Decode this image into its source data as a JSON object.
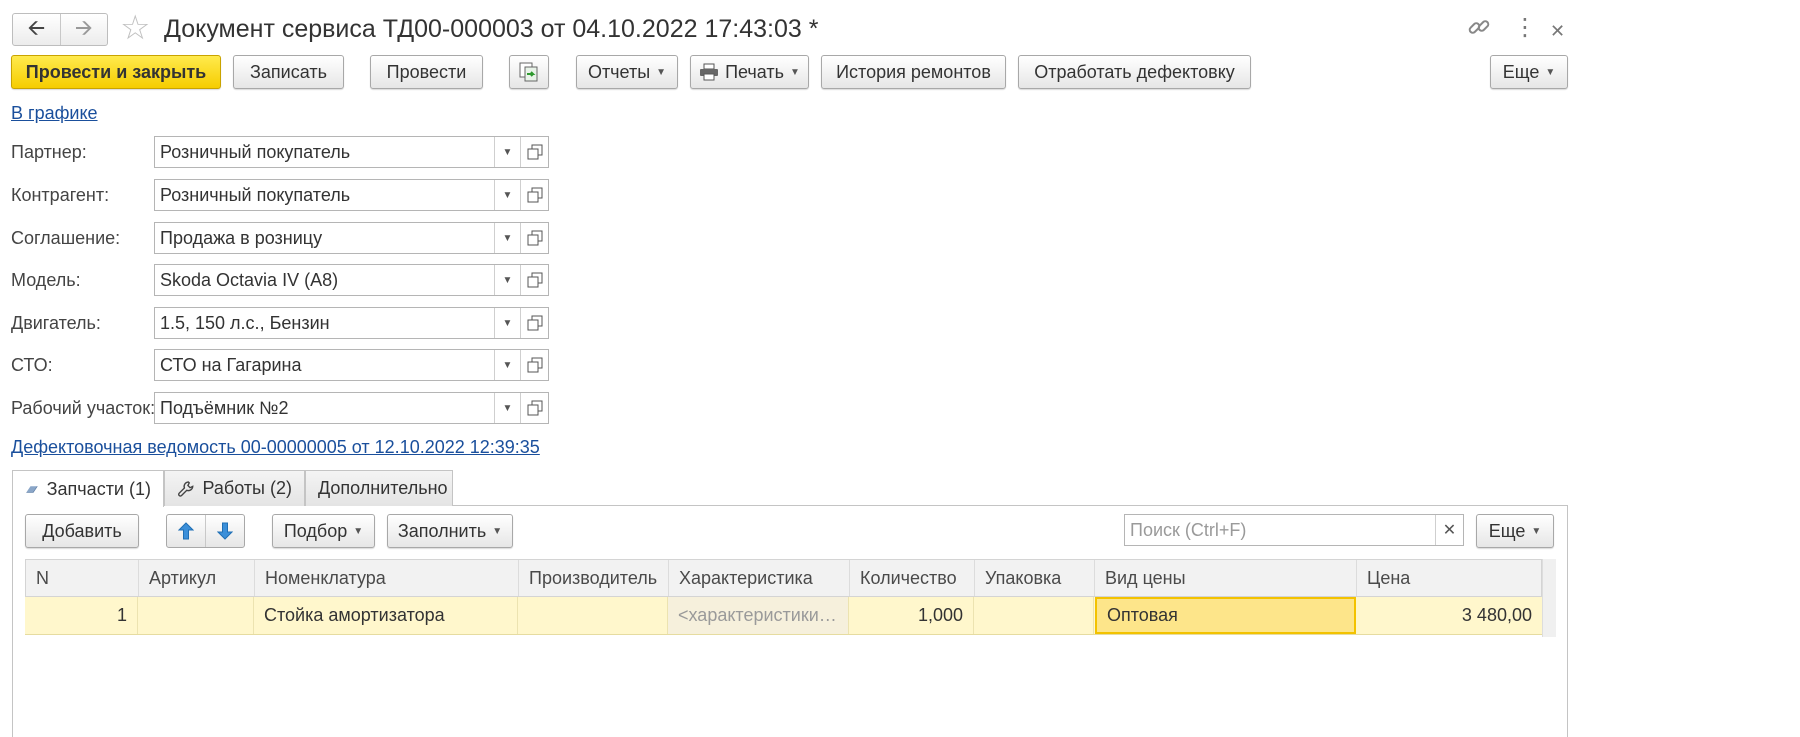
{
  "window": {
    "title": "Документ сервиса ТД00-000003 от 04.10.2022 17:43:03 *"
  },
  "toolbar": {
    "post_close": "Провести и закрыть",
    "save": "Записать",
    "post": "Провести",
    "reports": "Отчеты",
    "print": "Печать",
    "repair_history": "История ремонтов",
    "defect_work": "Отработать дефектовку",
    "more": "Еще"
  },
  "links": {
    "schedule": "В графике",
    "defect_sheet": "Дефектовочная ведомость 00-00000005 от 12.10.2022 12:39:35"
  },
  "form": {
    "fields": [
      {
        "label": "Партнер:",
        "value": "Розничный покупатель"
      },
      {
        "label": "Контрагент:",
        "value": "Розничный покупатель"
      },
      {
        "label": "Соглашение:",
        "value": "Продажа в розницу"
      },
      {
        "label": "Модель:",
        "value": "Skoda Octavia IV (A8)"
      },
      {
        "label": "Двигатель:",
        "value": "1.5, 150 л.с., Бензин"
      },
      {
        "label": "СТО:",
        "value": "СТО на Гагарина"
      },
      {
        "label": "Рабочий участок:",
        "value": "Подъёмник №2"
      }
    ]
  },
  "tabs": [
    {
      "label": "Запчасти (1)"
    },
    {
      "label": "Работы (2)"
    },
    {
      "label": "Дополнительно"
    }
  ],
  "table_toolbar": {
    "add": "Добавить",
    "pick": "Подбор",
    "fill": "Заполнить",
    "search_placeholder": "Поиск (Ctrl+F)",
    "more": "Еще"
  },
  "table": {
    "columns": [
      "N",
      "Артикул",
      "Номенклатура",
      "Производитель",
      "Характеристика",
      "Количество",
      "Упаковка",
      "Вид цены",
      "Цена"
    ],
    "rows": [
      {
        "n": "1",
        "article": "",
        "nomenclature": "Стойка амортизатора",
        "manufacturer": "",
        "characteristic": "<характеристики ...",
        "quantity": "1,000",
        "packaging": "",
        "price_type": "Оптовая",
        "price": "3 480,00"
      }
    ]
  },
  "colors": {
    "primary_button": "#f6cd00",
    "link": "#1a4f9c",
    "selected_row": "#fff7cc",
    "selected_cell_border": "#f3c200"
  }
}
